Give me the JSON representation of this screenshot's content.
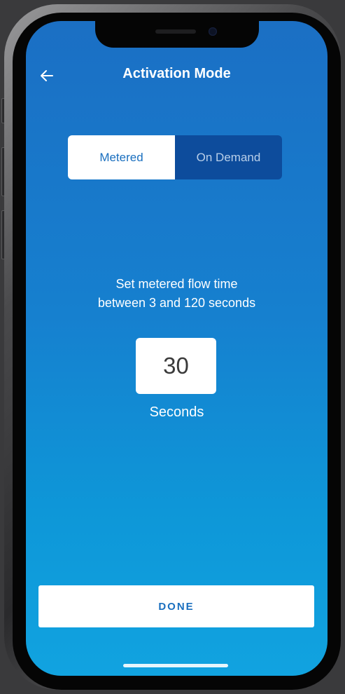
{
  "header": {
    "title": "Activation Mode",
    "back_icon": "arrow-left-icon"
  },
  "mode_toggle": {
    "options": [
      {
        "label": "Metered",
        "selected": true
      },
      {
        "label": "On Demand",
        "selected": false
      }
    ]
  },
  "metered": {
    "instruction_line1": "Set metered flow time",
    "instruction_line2": "between 3 and 120 seconds",
    "value": "30",
    "unit_label": "Seconds"
  },
  "footer": {
    "done_label": "DONE"
  },
  "colors": {
    "accent": "#1a6fbf",
    "background_top": "#1b6fc4",
    "background_bottom": "#11a3e0",
    "inactive_segment": "#0d4c9c"
  }
}
